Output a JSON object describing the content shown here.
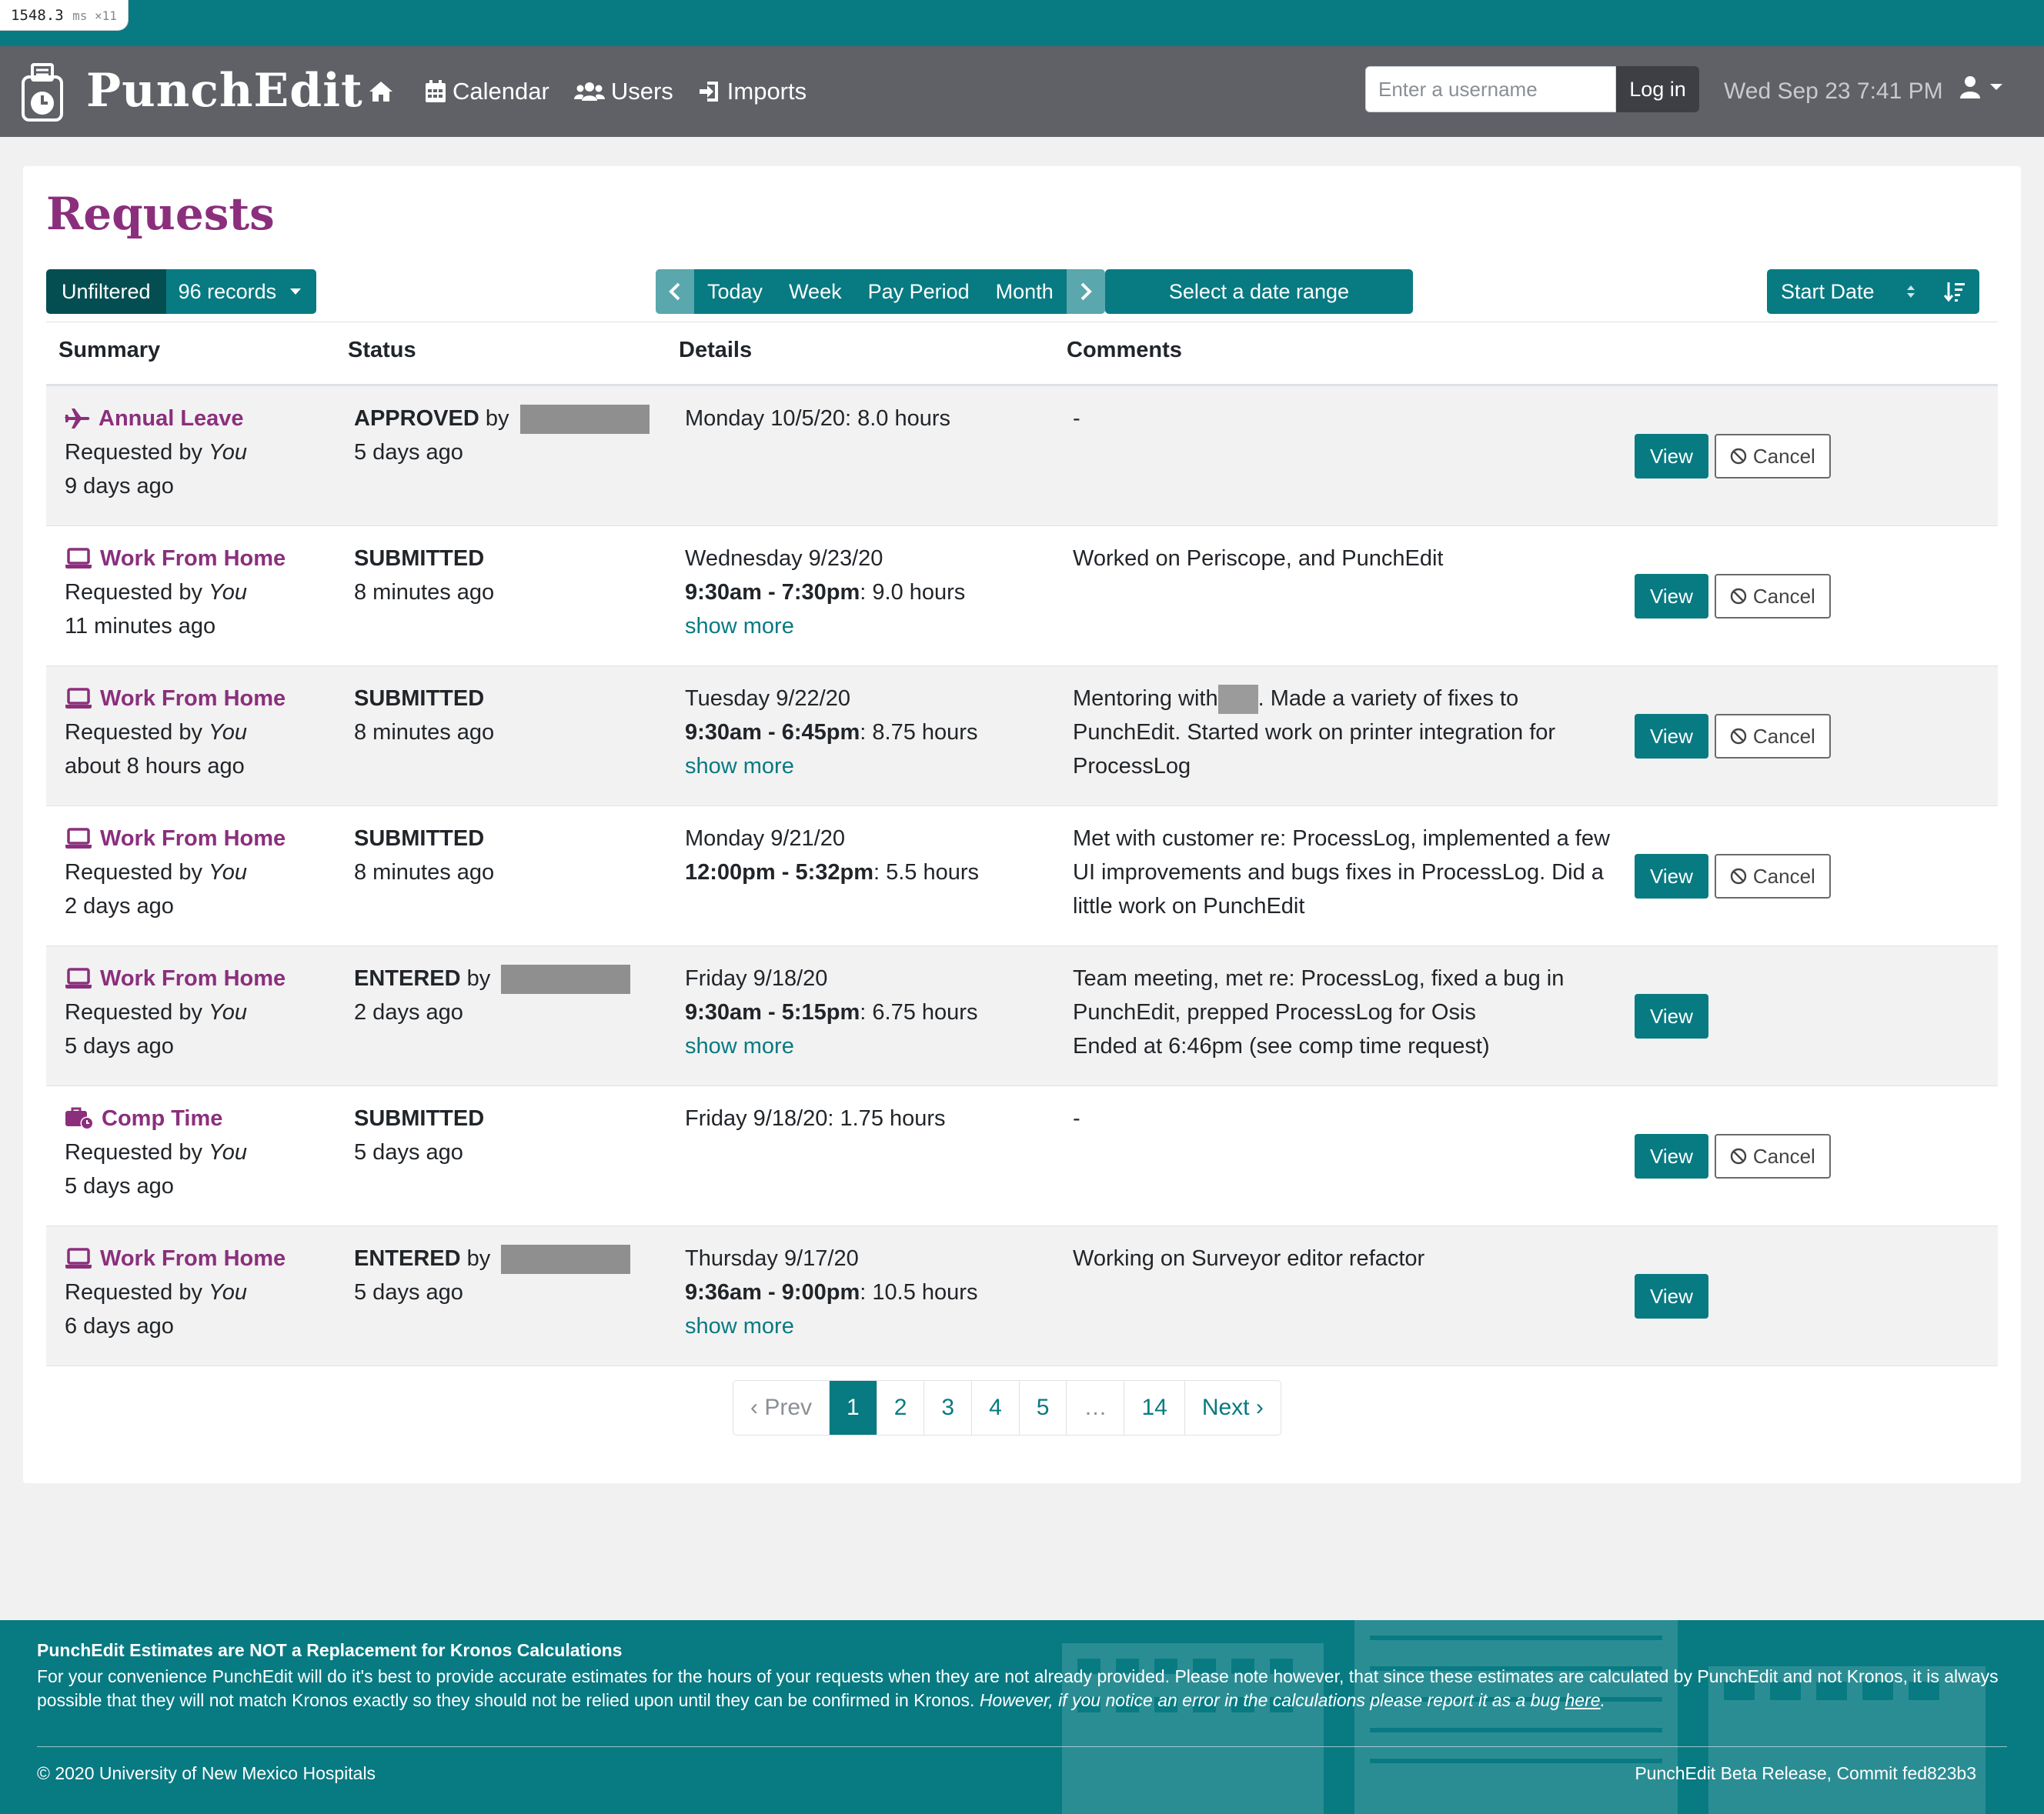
{
  "perf": {
    "value": "1548.3",
    "unit": "ms ×11"
  },
  "app": {
    "brand": "PunchEdit"
  },
  "nav": {
    "links": [
      {
        "label": ""
      },
      {
        "label": "Calendar"
      },
      {
        "label": "Users"
      },
      {
        "label": "Imports"
      }
    ],
    "login": {
      "placeholder": "Enter a username",
      "button": "Log in"
    },
    "datetime": "Wed Sep 23 7:41 PM"
  },
  "page": {
    "title": "Requests",
    "filter": {
      "unfiltered": "Unfiltered",
      "records": "96 records"
    },
    "range": {
      "today": "Today",
      "week": "Week",
      "pay_period": "Pay Period",
      "month": "Month"
    },
    "select_range": "Select a date range",
    "sort": {
      "label": "Start Date"
    }
  },
  "table": {
    "headers": {
      "summary": "Summary",
      "status": "Status",
      "details": "Details",
      "comments": "Comments"
    },
    "rows": [
      {
        "type": "Annual Leave",
        "icon": "plane-icon",
        "requested_by": "Requested by ",
        "who": "You",
        "age": "9 days ago",
        "status": "APPROVED",
        "by": " by",
        "status_time": "5 days ago",
        "date": "Monday 10/5/20: 8.0 hours",
        "time": "",
        "hours": "",
        "show_more": "",
        "comment": "-",
        "view": "View",
        "cancel": "Cancel"
      },
      {
        "type": "Work From Home",
        "icon": "laptop-icon",
        "requested_by": "Requested by ",
        "who": "You",
        "age": "11 minutes ago",
        "status": "SUBMITTED",
        "by": "",
        "status_time": "8 minutes ago",
        "date": "Wednesday 9/23/20",
        "time": "9:30am - 7:30pm",
        "hours": ": 9.0 hours",
        "show_more": "show more",
        "comment": "Worked on Periscope, and PunchEdit",
        "view": "View",
        "cancel": "Cancel"
      },
      {
        "type": "Work From Home",
        "icon": "laptop-icon",
        "requested_by": "Requested by ",
        "who": "You",
        "age": "about 8 hours ago",
        "status": "SUBMITTED",
        "by": "",
        "status_time": "8 minutes ago",
        "date": "Tuesday 9/22/20",
        "time": "9:30am - 6:45pm",
        "hours": ": 8.75 hours",
        "show_more": "show more",
        "comment_pre": "Mentoring with",
        "comment_post": ". Made a variety of fixes to PunchEdit. Started work on printer integration for ProcessLog",
        "view": "View",
        "cancel": "Cancel"
      },
      {
        "type": "Work From Home",
        "icon": "laptop-icon",
        "requested_by": "Requested by ",
        "who": "You",
        "age": "2 days ago",
        "status": "SUBMITTED",
        "by": "",
        "status_time": "8 minutes ago",
        "date": "Monday 9/21/20",
        "time": "12:00pm - 5:32pm",
        "hours": ": 5.5 hours",
        "show_more": "",
        "comment": "Met with customer re: ProcessLog, implemented a few UI improvements and bugs fixes in ProcessLog. Did a little work on PunchEdit",
        "view": "View",
        "cancel": "Cancel"
      },
      {
        "type": "Work From Home",
        "icon": "laptop-icon",
        "requested_by": "Requested by ",
        "who": "You",
        "age": "5 days ago",
        "status": "ENTERED",
        "by": " by",
        "status_time": "2 days ago",
        "date": "Friday 9/18/20",
        "time": "9:30am - 5:15pm",
        "hours": ": 6.75 hours",
        "show_more": "show more",
        "comment": "Team meeting, met re: ProcessLog, fixed a bug in PunchEdit, prepped ProcessLog for Osis",
        "comment2": "Ended at 6:46pm (see comp time request)",
        "view": "View",
        "cancel": ""
      },
      {
        "type": "Comp Time",
        "icon": "briefcase-clock-icon",
        "requested_by": "Requested by ",
        "who": "You",
        "age": "5 days ago",
        "status": "SUBMITTED",
        "by": "",
        "status_time": "5 days ago",
        "date": "Friday 9/18/20: 1.75 hours",
        "time": "",
        "hours": "",
        "show_more": "",
        "comment": "-",
        "view": "View",
        "cancel": "Cancel"
      },
      {
        "type": "Work From Home",
        "icon": "laptop-icon",
        "requested_by": "Requested by ",
        "who": "You",
        "age": "6 days ago",
        "status": "ENTERED",
        "by": " by",
        "status_time": "5 days ago",
        "date": "Thursday 9/17/20",
        "time": "9:36am - 9:00pm",
        "hours": ": 10.5 hours",
        "show_more": "show more",
        "comment": "Working on Surveyor editor refactor",
        "view": "View",
        "cancel": ""
      }
    ]
  },
  "pagination": {
    "prev": "‹ Prev",
    "pages": [
      "1",
      "2",
      "3",
      "4",
      "5"
    ],
    "ellipsis": "…",
    "last": "14",
    "next": "Next ›",
    "active": "1"
  },
  "footer": {
    "title": "PunchEdit Estimates are NOT a Replacement for Kronos Calculations",
    "body": "For your convenience PunchEdit will do it's best to provide accurate estimates for the hours of your requests when they are not already provided. Please note however, that since these estimates are calculated by PunchEdit and not Kronos, it is always possible that they will not match Kronos exactly so they should not be relied upon until they can be confirmed in Kronos. ",
    "body_italic": "However, if you notice an error in the calculations please report it as a bug ",
    "link": "here",
    "link_end": ".",
    "copyright": "© 2020 University of New Mexico Hospitals",
    "commit": "PunchEdit Beta Release, Commit fed823b3"
  },
  "colors": {
    "teal": "#087a82",
    "purple": "#8b2f7d",
    "navbar": "#5f6167"
  }
}
